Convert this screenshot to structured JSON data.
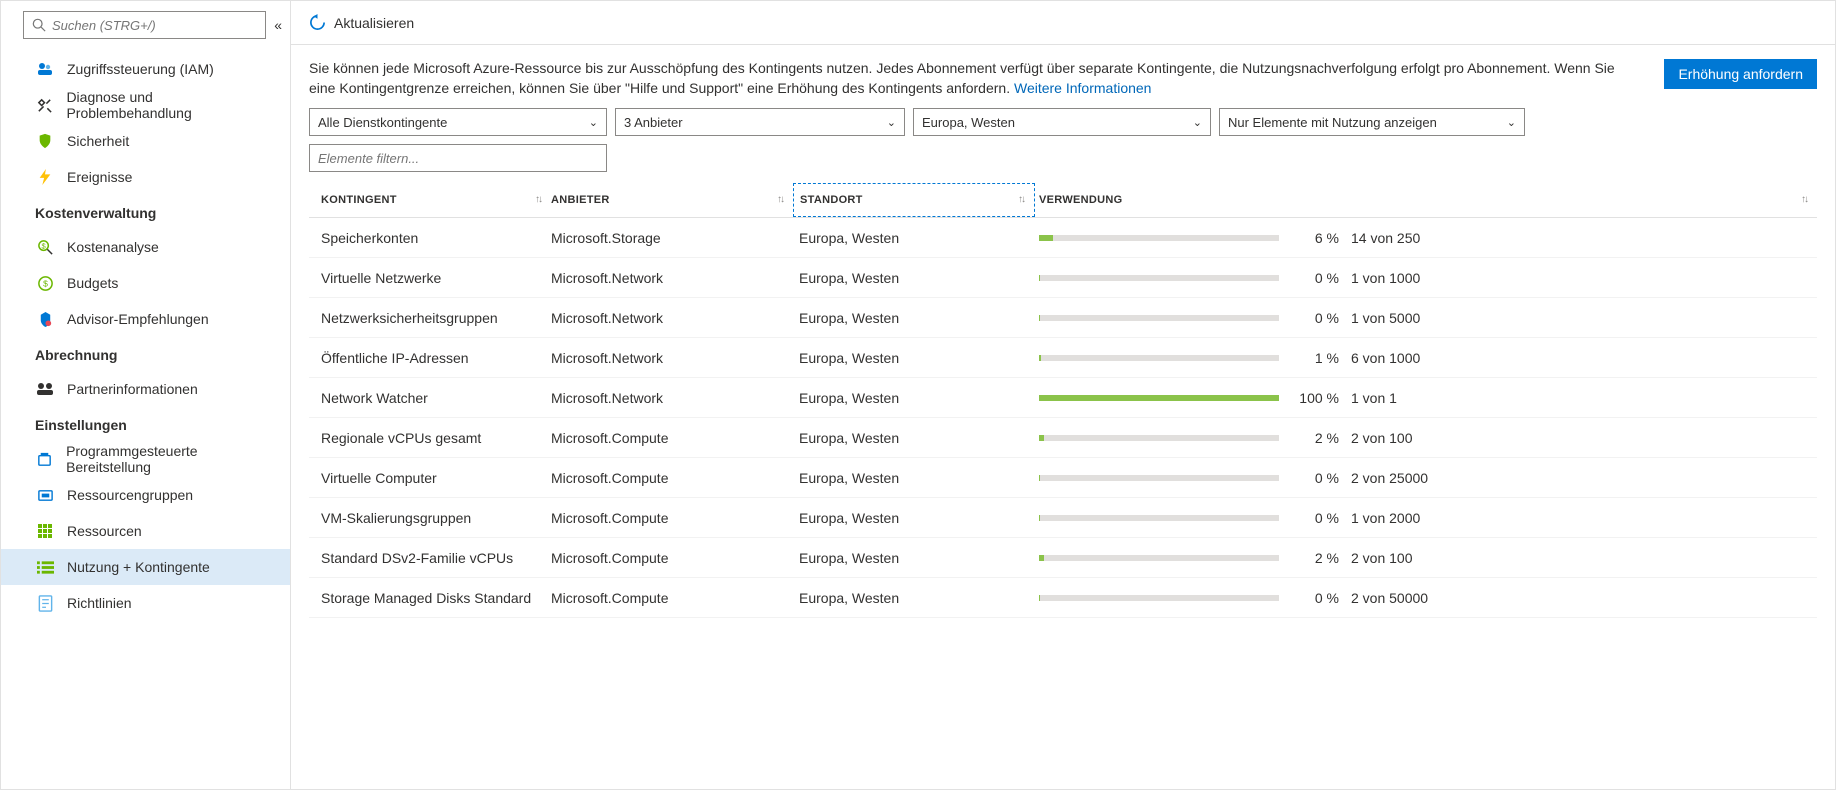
{
  "sidebar": {
    "search_placeholder": "Suchen (STRG+/)",
    "items_top": [
      {
        "label": "Zugriffssteuerung (IAM)",
        "icon": "iam"
      },
      {
        "label": "Diagnose und Problembehandlung",
        "icon": "diag"
      },
      {
        "label": "Sicherheit",
        "icon": "security"
      },
      {
        "label": "Ereignisse",
        "icon": "events"
      }
    ],
    "section_cost": "Kostenverwaltung",
    "items_cost": [
      {
        "label": "Kostenanalyse",
        "icon": "costanalysis"
      },
      {
        "label": "Budgets",
        "icon": "budgets"
      },
      {
        "label": "Advisor-Empfehlungen",
        "icon": "advisor"
      }
    ],
    "section_billing": "Abrechnung",
    "items_billing": [
      {
        "label": "Partnerinformationen",
        "icon": "partner"
      }
    ],
    "section_settings": "Einstellungen",
    "items_settings": [
      {
        "label": "Programmgesteuerte Bereitstellung",
        "icon": "deploy"
      },
      {
        "label": "Ressourcengruppen",
        "icon": "rg"
      },
      {
        "label": "Ressourcen",
        "icon": "resources"
      },
      {
        "label": "Nutzung + Kontingente",
        "icon": "usage",
        "active": true
      },
      {
        "label": "Richtlinien",
        "icon": "policy"
      }
    ]
  },
  "toolbar": {
    "refresh_label": "Aktualisieren"
  },
  "description": {
    "text_part1": "Sie können jede Microsoft Azure-Ressource bis zur Ausschöpfung des Kontingents nutzen. Jedes Abonnement verfügt über separate Kontingente, die Nutzungsnachverfolgung erfolgt pro Abonnement. Wenn Sie eine Kontingentgrenze erreichen, können Sie über \"Hilfe und Support\" eine Erhöhung des Kontingents anfordern. ",
    "link_text": "Weitere Informationen",
    "button_label": "Erhöhung anfordern"
  },
  "filters": {
    "dd1": "Alle Dienstkontingente",
    "dd2": "3 Anbieter",
    "dd3": "Europa, Westen",
    "dd4": "Nur Elemente mit Nutzung anzeigen",
    "filter_placeholder": "Elemente filtern..."
  },
  "columns": {
    "kontingent": "KONTINGENT",
    "anbieter": "ANBIETER",
    "standort": "STANDORT",
    "verwendung": "VERWENDUNG"
  },
  "rows": [
    {
      "kont": "Speicherkonten",
      "anb": "Microsoft.Storage",
      "stand": "Europa, Westen",
      "pct": 6,
      "pct_label": "6 %",
      "usage": "14 von 250"
    },
    {
      "kont": "Virtuelle Netzwerke",
      "anb": "Microsoft.Network",
      "stand": "Europa, Westen",
      "pct": 0,
      "pct_label": "0 %",
      "usage": "1 von 1000"
    },
    {
      "kont": "Netzwerksicherheitsgruppen",
      "anb": "Microsoft.Network",
      "stand": "Europa, Westen",
      "pct": 0,
      "pct_label": "0 %",
      "usage": "1 von 5000"
    },
    {
      "kont": "Öffentliche IP-Adressen",
      "anb": "Microsoft.Network",
      "stand": "Europa, Westen",
      "pct": 1,
      "pct_label": "1 %",
      "usage": "6 von 1000"
    },
    {
      "kont": "Network Watcher",
      "anb": "Microsoft.Network",
      "stand": "Europa, Westen",
      "pct": 100,
      "pct_label": "100 %",
      "usage": "1 von 1"
    },
    {
      "kont": "Regionale vCPUs gesamt",
      "anb": "Microsoft.Compute",
      "stand": "Europa, Westen",
      "pct": 2,
      "pct_label": "2 %",
      "usage": "2 von 100"
    },
    {
      "kont": "Virtuelle Computer",
      "anb": "Microsoft.Compute",
      "stand": "Europa, Westen",
      "pct": 0,
      "pct_label": "0 %",
      "usage": "2 von 25000"
    },
    {
      "kont": "VM-Skalierungsgruppen",
      "anb": "Microsoft.Compute",
      "stand": "Europa, Westen",
      "pct": 0,
      "pct_label": "0 %",
      "usage": "1 von 2000"
    },
    {
      "kont": "Standard DSv2-Familie vCPUs",
      "anb": "Microsoft.Compute",
      "stand": "Europa, Westen",
      "pct": 2,
      "pct_label": "2 %",
      "usage": "2 von 100"
    },
    {
      "kont": "Storage Managed Disks Standard",
      "anb": "Microsoft.Compute",
      "stand": "Europa, Westen",
      "pct": 0,
      "pct_label": "0 %",
      "usage": "2 von 50000"
    }
  ]
}
